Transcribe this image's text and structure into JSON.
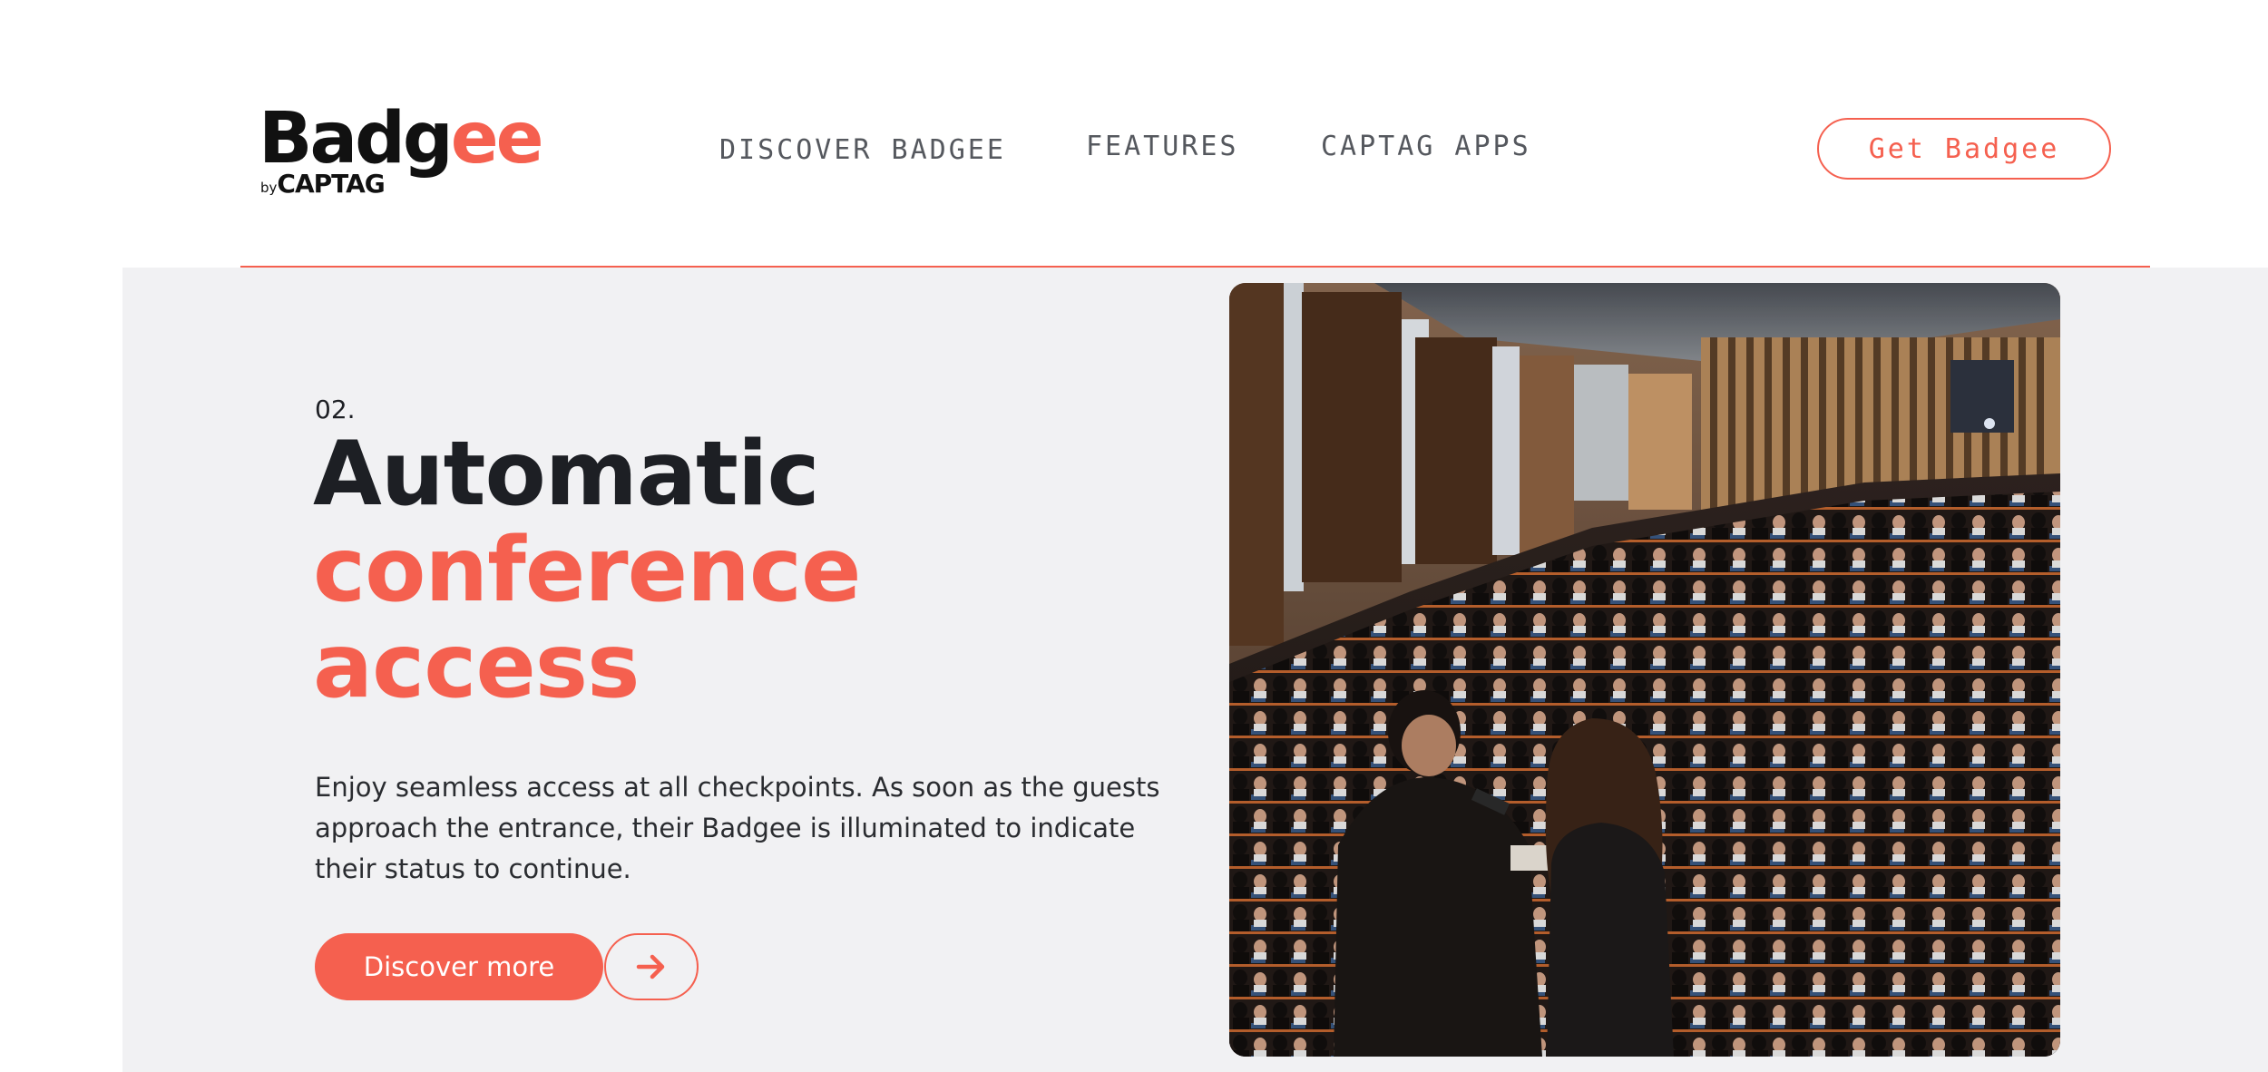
{
  "brand": {
    "logo_main": "Badg",
    "logo_accent": "ee",
    "logo_by": "by",
    "logo_sub": "CAPTAG",
    "accent_color": "#f5604f",
    "dark_color": "#1d1f24"
  },
  "nav": {
    "items": [
      {
        "label": "DISCOVER BADGEE"
      },
      {
        "label": "FEATURES"
      },
      {
        "label": "CAPTAG APPS"
      }
    ],
    "cta_label": "Get Badgee"
  },
  "hero": {
    "section_number": "02.",
    "headline_line1": "Automatic",
    "headline_line2": "conference",
    "headline_line3": "access",
    "body": "Enjoy seamless access at all checkpoints. As soon as the guests approach the entrance, their Badgee is illuminated to indicate their status to continue.",
    "primary_button": "Discover more",
    "arrow_icon": "arrow-right-icon",
    "photo_subject": "conference-audience-photo"
  }
}
